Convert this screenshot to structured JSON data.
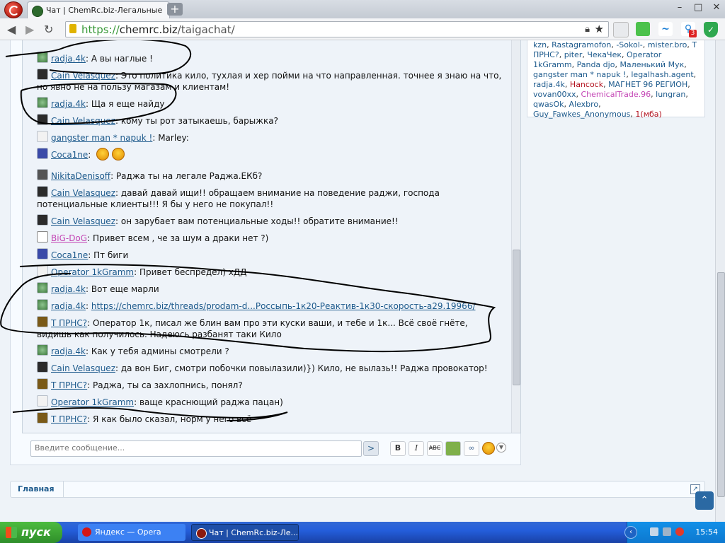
{
  "browser": {
    "tab_title": "Чат | ChemRc.biz-Легальные",
    "new_tab": "+",
    "url_scheme": "https://",
    "url_host": "chemrc.biz",
    "url_path": "/taigachat/",
    "window_buttons": {
      "minimize": "–",
      "maximize": "□",
      "close": "✕"
    },
    "extension_badge": "3"
  },
  "chat": {
    "messages": [
      {
        "user": "radja.4k",
        "text": "А вы наглые !",
        "avatar": "radja"
      },
      {
        "user": "Cain Velasquez",
        "text": "Это политика кило, тухлая и хер пойми на что направленная. точнее я знаю на что, но явно не на пользу магазам и клиентам!",
        "avatar": "cain"
      },
      {
        "user": "radja.4k",
        "text": "Ща я еще найду",
        "avatar": "radja"
      },
      {
        "user": "Cain Velasquez",
        "text": "кому ты рот затыкаешь, барыжка?",
        "avatar": "cain"
      },
      {
        "user": "gangster man * napuk !",
        "text": "Marley:",
        "avatar": "blank"
      },
      {
        "user": "Coca1ne",
        "text": "",
        "avatar": "coca"
      },
      {
        "user": "NikitaDenisoff",
        "text": "Раджа ты на легале Раджа.ЕКб?",
        "avatar": "nik"
      },
      {
        "user": "Cain Velasquez",
        "text": "давай давай ищи!! обращаем внимание на поведение раджи, господа потенциальные клиенты!!! Я бы у него не покупал!!",
        "avatar": "cain"
      },
      {
        "user": "Cain Velasquez",
        "text": "он зарубает вам потенциальные ходы!! обратите внимание!!",
        "avatar": "cain"
      },
      {
        "user": "BiG-DoG",
        "text": "Привет всем , че за шум а драки нет ?)",
        "avatar": "big"
      },
      {
        "user": "Coca1ne",
        "text": "Пт биги",
        "avatar": "coca"
      },
      {
        "user": "Operator 1kGramm",
        "text": "Привет беспредел) хДД",
        "avatar": "blank"
      },
      {
        "user": "radja.4k",
        "text": "Вот еще марли",
        "avatar": "radja"
      },
      {
        "user": "radja.4k",
        "text": "https://chemrc.biz/threads/prodam-d...Россыпь-1к20-Реактив-1к30-скорость-a29.19966/",
        "avatar": "radja"
      },
      {
        "user": "Т ПРНС?",
        "text": "Оператор 1к, писал же блин вам про эти куски ваши, и тебе и 1к... Всё своё гнёте, видишь как получилось. Надеюсь разбанят таки Кило",
        "avatar": "trns"
      },
      {
        "user": "radja.4k",
        "text": "Как у тебя админы смотрели ?",
        "avatar": "radja"
      },
      {
        "user": "Cain Velasquez",
        "text": "да вон Биг, смотри побочки повылазили)}) Кило, не вылазь!! Раджа провокатор!",
        "avatar": "cain"
      },
      {
        "user": "Т ПРНС?",
        "text": "Раджа, ты са захлопнись, понял?",
        "avatar": "trns"
      },
      {
        "user": "Operator 1kGramm",
        "text": "ваще краснющий раджа пацан)",
        "avatar": "blank"
      },
      {
        "user": "Т ПРНС?",
        "text": "Я как было сказал, норм у него всё",
        "avatar": "trns"
      }
    ],
    "input_placeholder": "Введите сообщение...",
    "send_label": ">",
    "format_bold": "B",
    "format_italic": "I",
    "format_strike": "ABC"
  },
  "online_users": [
    {
      "name": "kzn",
      "color": "plain"
    },
    {
      "name": "Rastagramofon",
      "color": "plain"
    },
    {
      "name": "-Sokol-",
      "color": "plain"
    },
    {
      "name": "mister.bro",
      "color": "plain"
    },
    {
      "name": "Т ПРНС?",
      "color": "plain"
    },
    {
      "name": "piter",
      "color": "plain"
    },
    {
      "name": "ЧекаЧек",
      "color": "plain"
    },
    {
      "name": "Operator 1kGramm",
      "color": "plain"
    },
    {
      "name": "Panda djo",
      "color": "plain"
    },
    {
      "name": "Маленький Мук",
      "color": "plain"
    },
    {
      "name": "gangster man * napuk !",
      "color": "plain"
    },
    {
      "name": "legalhash.agent",
      "color": "plain"
    },
    {
      "name": "radja.4k",
      "color": "plain"
    },
    {
      "name": "Hancock",
      "color": "red"
    },
    {
      "name": "МАГНЕТ 96 РЕГИОН",
      "color": "plain"
    },
    {
      "name": "vovan00xx",
      "color": "plain"
    },
    {
      "name": "ChemicalTrade.96",
      "color": "pink"
    },
    {
      "name": "lungran",
      "color": "plain"
    },
    {
      "name": "qwasOk",
      "color": "plain"
    },
    {
      "name": "Alexbro",
      "color": "plain"
    },
    {
      "name": "Guy_Fawkes_Anonymous",
      "color": "plain"
    }
  ],
  "online_extra": "1(мба)",
  "breadcrumb": {
    "home": "Главная"
  },
  "taskbar": {
    "start_label": "пуск",
    "task1": "Яндекс — Opera",
    "task2": "Чат | ChemRc.biz-Ле...",
    "clock": "15:54"
  }
}
